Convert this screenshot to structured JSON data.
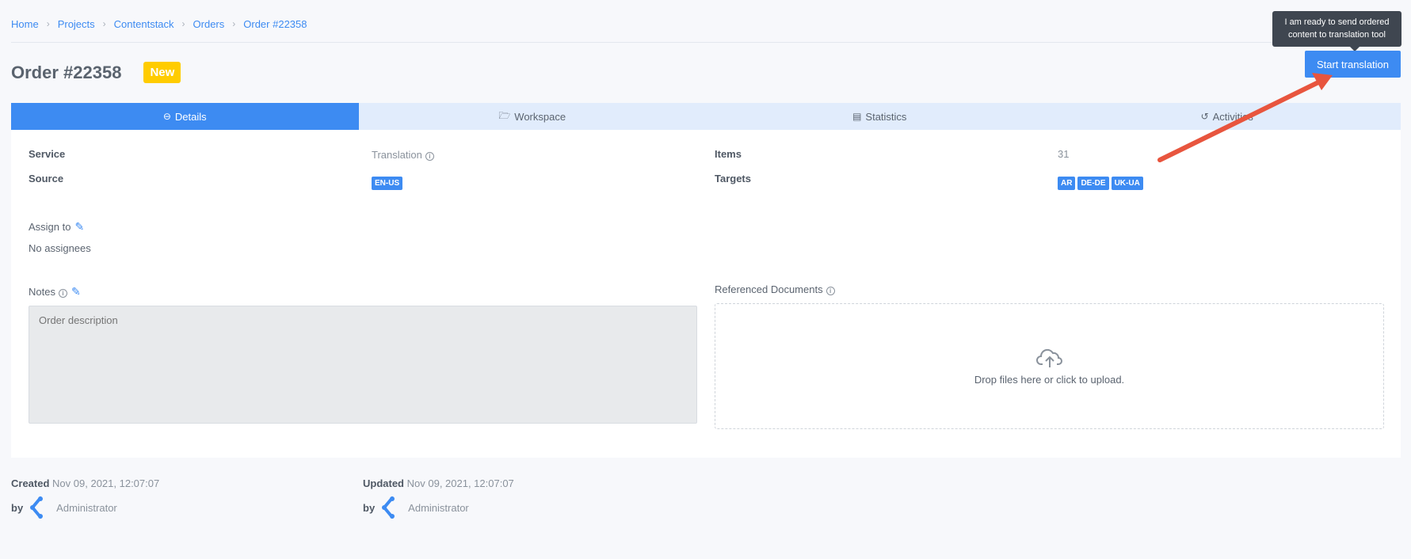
{
  "breadcrumb": [
    "Home",
    "Projects",
    "Contentstack",
    "Orders",
    "Order #22358"
  ],
  "page": {
    "title": "Order #22358",
    "status_badge": "New",
    "start_button": "Start translation",
    "tooltip_line1": "I am ready to send ordered",
    "tooltip_line2": "content to translation tool"
  },
  "tabs": [
    {
      "label": "Details",
      "icon": "minus-circle-icon",
      "active": true
    },
    {
      "label": "Workspace",
      "icon": "folder-open-icon",
      "active": false
    },
    {
      "label": "Statistics",
      "icon": "chart-icon",
      "active": false
    },
    {
      "label": "Activities",
      "icon": "history-icon",
      "active": false
    }
  ],
  "details": {
    "service_label": "Service",
    "service_value": "Translation",
    "source_label": "Source",
    "source_value": "EN-US",
    "items_label": "Items",
    "items_value": "31",
    "targets_label": "Targets",
    "targets": [
      "AR",
      "DE-DE",
      "UK-UA"
    ],
    "assign_label": "Assign to",
    "assign_value": "No assignees",
    "notes_label": "Notes",
    "notes_placeholder": "Order description",
    "ref_docs_label": "Referenced Documents",
    "dropzone_text": "Drop files here or click to upload."
  },
  "footer": {
    "created_label": "Created",
    "created_value": "Nov 09, 2021, 12:07:07",
    "updated_label": "Updated",
    "updated_value": "Nov 09, 2021, 12:07:07",
    "by_label": "by",
    "created_by": "Administrator",
    "updated_by": "Administrator"
  },
  "colors": {
    "accent": "#3d8bf2",
    "badge": "#ffcc00",
    "annotation_arrow": "#e8553e"
  }
}
